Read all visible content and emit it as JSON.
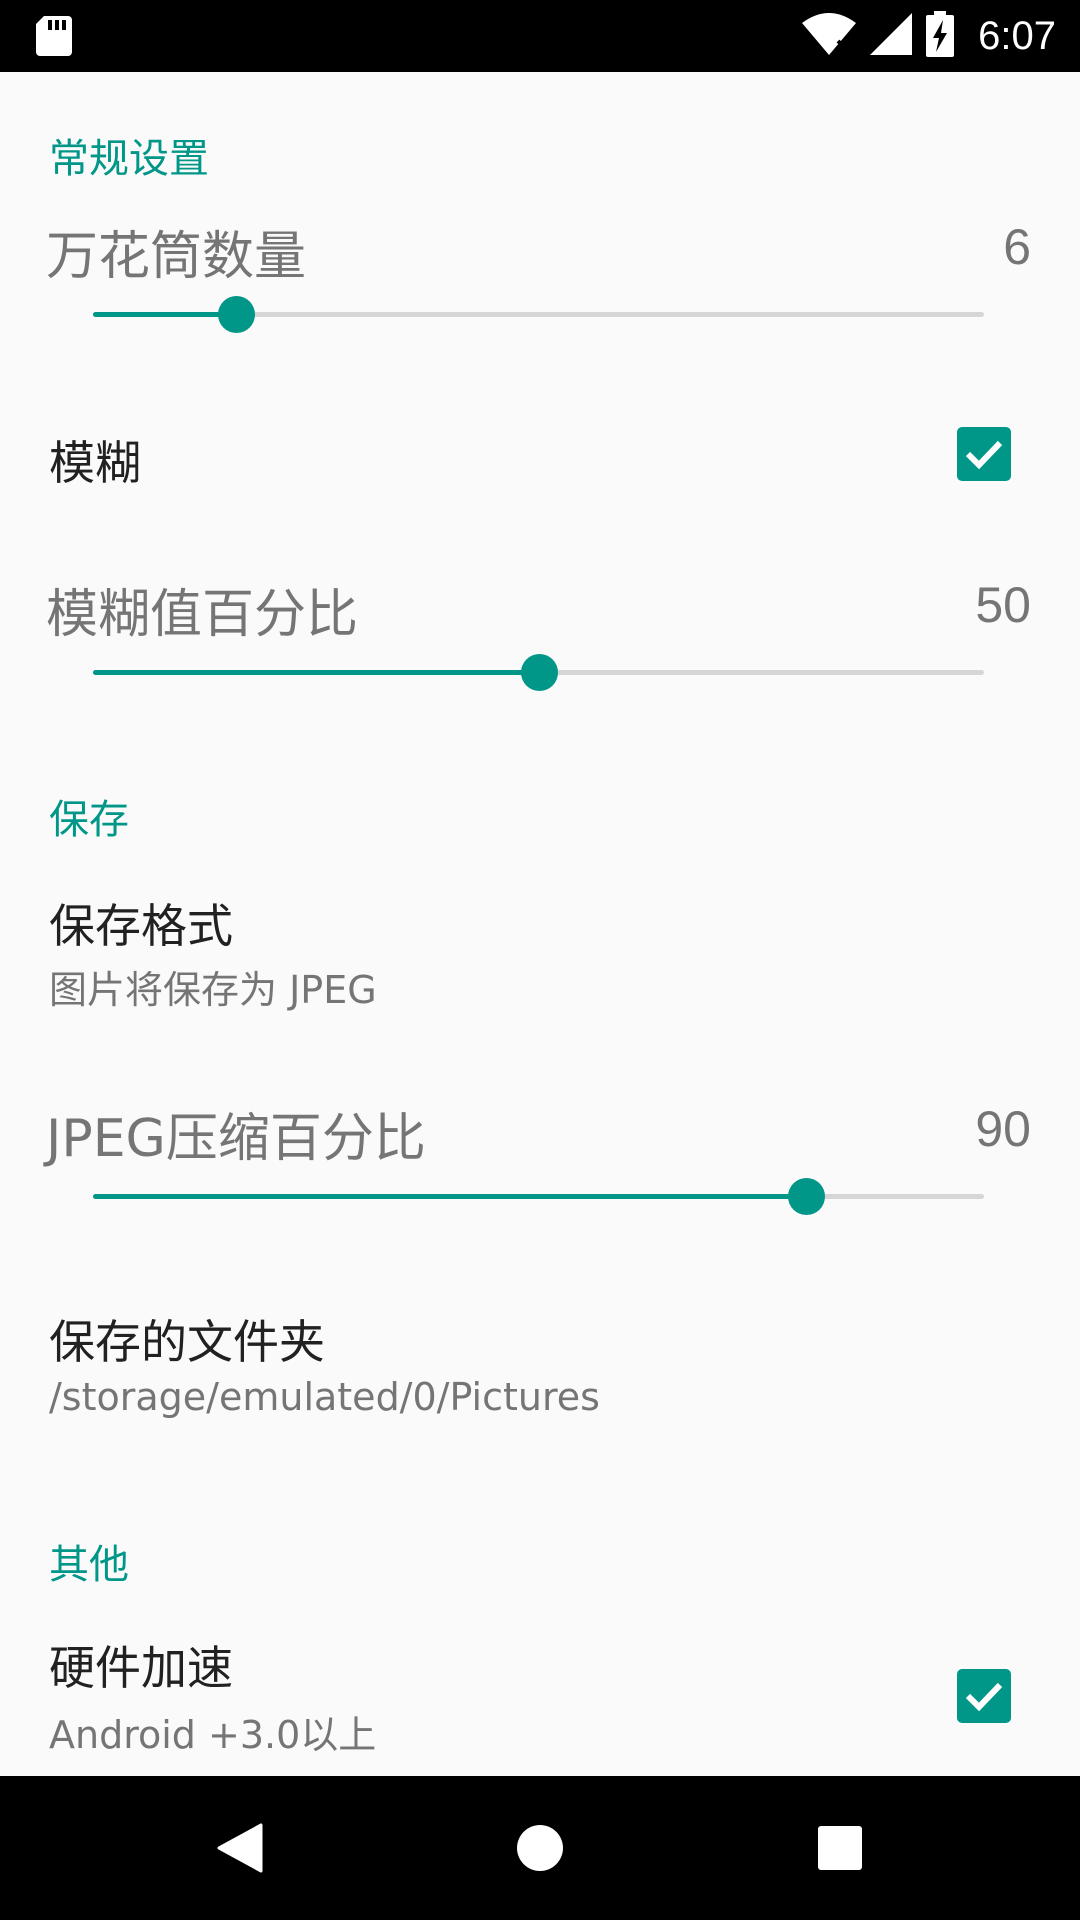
{
  "status_bar": {
    "time": "6:07",
    "icons": [
      "sd-card-icon",
      "wifi-icon",
      "signal-icon",
      "battery-charging-icon"
    ]
  },
  "sections": {
    "general": "常规设置",
    "save": "保存",
    "other": "其他"
  },
  "kaleidoscope": {
    "title": "万花筒数量",
    "value": "6",
    "fraction": 0.16
  },
  "blur": {
    "title": "模糊",
    "checked": true
  },
  "blur_percent": {
    "title": "模糊值百分比",
    "value": "50",
    "fraction": 0.5
  },
  "save_format": {
    "title": "保存格式",
    "summary": "图片将保存为 JPEG"
  },
  "jpeg_compression": {
    "title": "JPEG压缩百分比",
    "value": "90",
    "fraction": 0.8
  },
  "save_folder": {
    "title": "保存的文件夹",
    "summary": "/storage/emulated/0/Pictures"
  },
  "hw_accel": {
    "title": "硬件加速",
    "summary": "Android +3.0以上",
    "checked": true
  },
  "nav": {
    "icons": [
      "back-icon",
      "home-icon",
      "recents-icon"
    ]
  },
  "colors": {
    "accent": "#009688",
    "track": "#d6d6d6",
    "background": "#fafafa"
  }
}
